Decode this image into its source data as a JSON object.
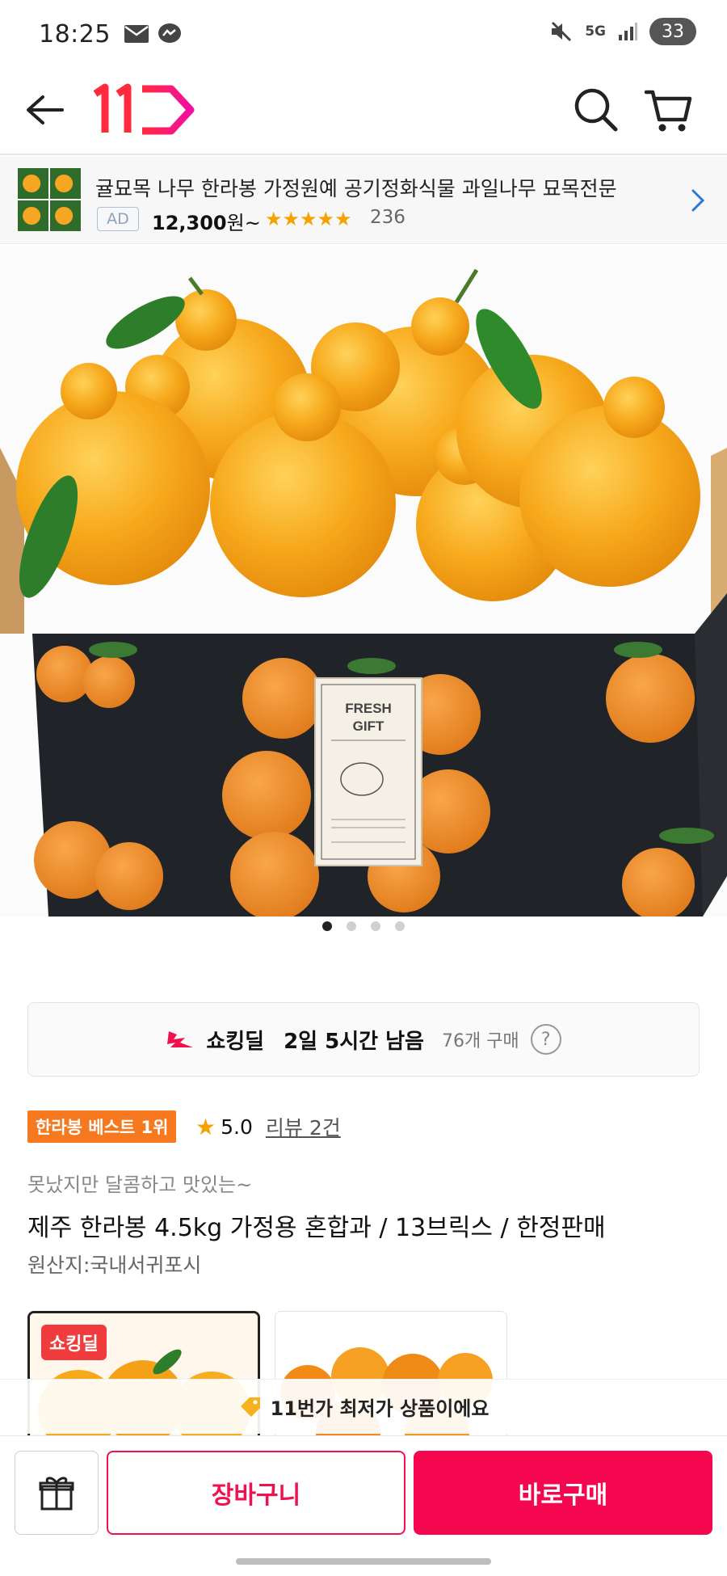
{
  "status_bar": {
    "time": "18:25",
    "battery": "33",
    "network": "5G",
    "icons": [
      "mail-icon",
      "messenger-icon",
      "mute-icon",
      "signal-icon"
    ]
  },
  "header": {
    "logo_text": "11",
    "brand_color": "#f0114e",
    "icons": [
      "back-arrow-icon",
      "search-icon",
      "cart-icon"
    ]
  },
  "ad": {
    "title": "귤묘목 나무 한라봉 가정원예 공기정화식물 과일나무 묘목전문",
    "badge": "AD",
    "price": "12,300",
    "price_unit": "원~",
    "stars": "★★★★★",
    "rating_value": 4.5,
    "review_count": "236"
  },
  "hero": {
    "box_label_line1": "FRESH",
    "box_label_line2": "GIFT",
    "slide_count": 4,
    "active_slide": 0
  },
  "deal": {
    "label": "쇼킹딜",
    "time_left": "2일 5시간 남음",
    "purchase_count": "76개 구매",
    "help": "?"
  },
  "product": {
    "rank_badge": "한라봉 베스트 1위",
    "rating": "5.0",
    "review_link": "리뷰 2건",
    "subtitle": "못났지만 달콤하고 맛있는~",
    "title": "제주 한라봉 4.5kg 가정용 혼합과 / 13브릭스 / 한정판매",
    "origin": "원산지:국내서귀포시"
  },
  "options": {
    "badge": "쇼킹딜"
  },
  "notice": {
    "text": "11번가 최저가 상품이에요"
  },
  "bottom_bar": {
    "cart_label": "장바구니",
    "buy_label": "바로구매",
    "accent": "#f4074f"
  }
}
